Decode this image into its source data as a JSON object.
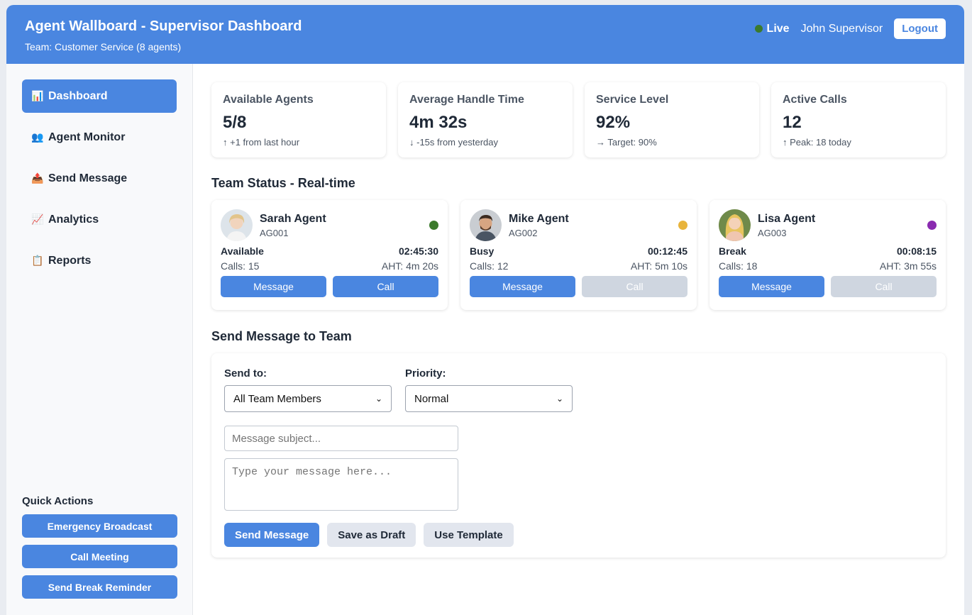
{
  "header": {
    "title": "Agent Wallboard - Supervisor Dashboard",
    "subtitle": "Team: Customer Service (8 agents)",
    "live_label": "Live",
    "live_color": "#3b7a2c",
    "user_name": "John Supervisor",
    "logout_label": "Logout"
  },
  "sidebar": {
    "items": [
      {
        "icon": "📊",
        "icon_name": "bar-chart-icon",
        "label": "Dashboard",
        "active": true
      },
      {
        "icon": "👥",
        "icon_name": "people-icon",
        "label": "Agent Monitor"
      },
      {
        "icon": "📤",
        "icon_name": "outbox-icon",
        "label": "Send Message"
      },
      {
        "icon": "📈",
        "icon_name": "trend-chart-icon",
        "label": "Analytics"
      },
      {
        "icon": "📋",
        "icon_name": "clipboard-icon",
        "label": "Reports"
      }
    ],
    "quick_actions": {
      "title": "Quick Actions",
      "buttons": [
        "Emergency Broadcast",
        "Call Meeting",
        "Send Break Reminder"
      ]
    }
  },
  "metrics": [
    {
      "label": "Available Agents",
      "value": "5/8",
      "change": "↑ +1 from last hour"
    },
    {
      "label": "Average Handle Time",
      "value": "4m 32s",
      "change": "↓ -15s from yesterday"
    },
    {
      "label": "Service Level",
      "value": "92%",
      "change": "→ Target: 90%"
    },
    {
      "label": "Active Calls",
      "value": "12",
      "change": "↑ Peak: 18 today"
    }
  ],
  "team_status": {
    "title": "Team Status - Real-time",
    "agents": [
      {
        "name": "Sarah Agent",
        "id": "AG001",
        "status": "Available",
        "status_color": "#3b7a2c",
        "timer": "02:45:30",
        "calls": "Calls: 15",
        "aht": "AHT: 4m 20s",
        "message_label": "Message",
        "call_label": "Call",
        "call_enabled": true
      },
      {
        "name": "Mike Agent",
        "id": "AG002",
        "status": "Busy",
        "status_color": "#e8b43c",
        "timer": "00:12:45",
        "calls": "Calls: 12",
        "aht": "AHT: 5m 10s",
        "message_label": "Message",
        "call_label": "Call",
        "call_enabled": false
      },
      {
        "name": "Lisa Agent",
        "id": "AG003",
        "status": "Break",
        "status_color": "#8a2bb0",
        "timer": "00:08:15",
        "calls": "Calls: 18",
        "aht": "AHT: 3m 55s",
        "message_label": "Message",
        "call_label": "Call",
        "call_enabled": false
      }
    ]
  },
  "send_message": {
    "title": "Send Message to Team",
    "send_to_label": "Send to:",
    "send_to_value": "All Team Members",
    "priority_label": "Priority:",
    "priority_value": "Normal",
    "subject_placeholder": "Message subject...",
    "body_placeholder": "Type your message here...",
    "send_label": "Send Message",
    "draft_label": "Save as Draft",
    "template_label": "Use Template"
  },
  "colors": {
    "accent": "#4a86e0"
  }
}
